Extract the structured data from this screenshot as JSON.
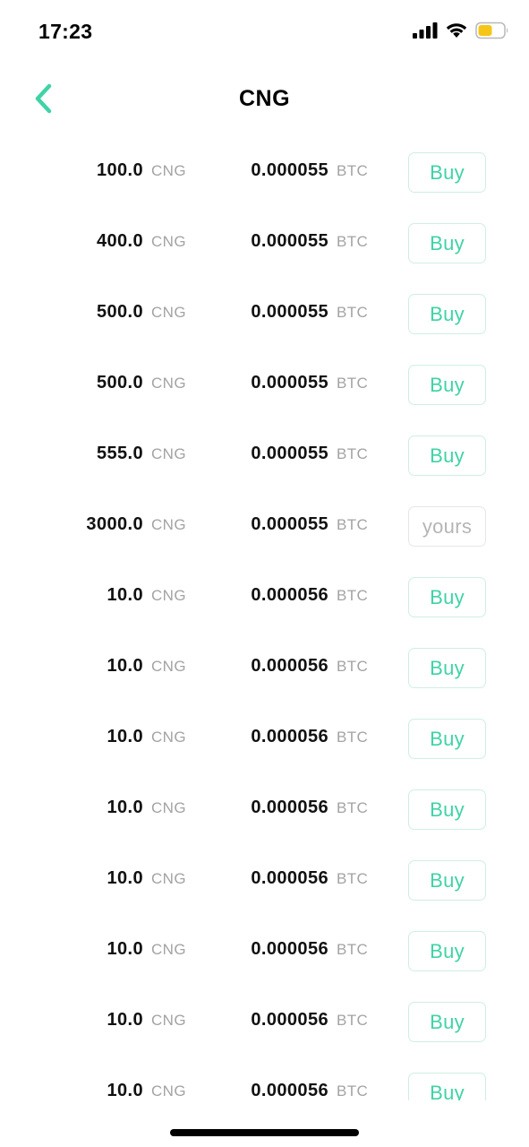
{
  "status_bar": {
    "time": "17:23",
    "icons": [
      "cellular-signal-icon",
      "wifi-icon",
      "battery-icon"
    ],
    "battery_color": "#f5c518"
  },
  "header": {
    "title": "CNG",
    "back_icon": "chevron-left-icon"
  },
  "colors": {
    "accent": "#3fd3a6",
    "button_border": "#cfeee4",
    "muted_text": "#a3a3a3"
  },
  "orders": [
    {
      "amount": "100.0",
      "amount_unit": "CNG",
      "price": "0.000055",
      "price_unit": "BTC",
      "action": "Buy",
      "mine": false
    },
    {
      "amount": "400.0",
      "amount_unit": "CNG",
      "price": "0.000055",
      "price_unit": "BTC",
      "action": "Buy",
      "mine": false
    },
    {
      "amount": "500.0",
      "amount_unit": "CNG",
      "price": "0.000055",
      "price_unit": "BTC",
      "action": "Buy",
      "mine": false
    },
    {
      "amount": "500.0",
      "amount_unit": "CNG",
      "price": "0.000055",
      "price_unit": "BTC",
      "action": "Buy",
      "mine": false
    },
    {
      "amount": "555.0",
      "amount_unit": "CNG",
      "price": "0.000055",
      "price_unit": "BTC",
      "action": "Buy",
      "mine": false
    },
    {
      "amount": "3000.0",
      "amount_unit": "CNG",
      "price": "0.000055",
      "price_unit": "BTC",
      "action": "yours",
      "mine": true
    },
    {
      "amount": "10.0",
      "amount_unit": "CNG",
      "price": "0.000056",
      "price_unit": "BTC",
      "action": "Buy",
      "mine": false
    },
    {
      "amount": "10.0",
      "amount_unit": "CNG",
      "price": "0.000056",
      "price_unit": "BTC",
      "action": "Buy",
      "mine": false
    },
    {
      "amount": "10.0",
      "amount_unit": "CNG",
      "price": "0.000056",
      "price_unit": "BTC",
      "action": "Buy",
      "mine": false
    },
    {
      "amount": "10.0",
      "amount_unit": "CNG",
      "price": "0.000056",
      "price_unit": "BTC",
      "action": "Buy",
      "mine": false
    },
    {
      "amount": "10.0",
      "amount_unit": "CNG",
      "price": "0.000056",
      "price_unit": "BTC",
      "action": "Buy",
      "mine": false
    },
    {
      "amount": "10.0",
      "amount_unit": "CNG",
      "price": "0.000056",
      "price_unit": "BTC",
      "action": "Buy",
      "mine": false
    },
    {
      "amount": "10.0",
      "amount_unit": "CNG",
      "price": "0.000056",
      "price_unit": "BTC",
      "action": "Buy",
      "mine": false
    },
    {
      "amount": "10.0",
      "amount_unit": "CNG",
      "price": "0.000056",
      "price_unit": "BTC",
      "action": "Buy",
      "mine": false
    }
  ]
}
